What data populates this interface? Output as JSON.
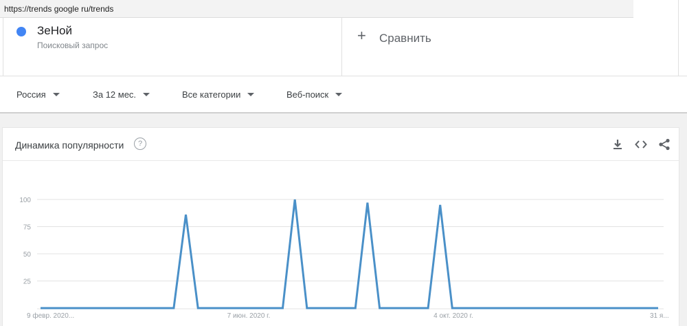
{
  "url_overlay": "https://trends google ru/trends",
  "term": {
    "name": "ЗеНой",
    "subtitle": "Поисковый запрос",
    "color": "#4285f4"
  },
  "compare": {
    "label": "Сравнить"
  },
  "filters": [
    {
      "label": "Россия"
    },
    {
      "label": "За 12 мес."
    },
    {
      "label": "Все категории"
    },
    {
      "label": "Веб-поиск"
    }
  ],
  "chart_card": {
    "title": "Динамика популярности",
    "help_glyph": "?"
  },
  "icons": {
    "download": "download-icon",
    "embed": "embed-code-icon",
    "share": "share-icon"
  },
  "chart_data": {
    "type": "line",
    "title": "Динамика популярности",
    "xlabel": "",
    "ylabel": "",
    "ylim": [
      0,
      100
    ],
    "yticks": [
      25,
      50,
      75,
      100
    ],
    "xtick_labels": [
      "9 февр. 2020...",
      "7 июн. 2020 г.",
      "4 окт. 2020 г.",
      "31 я..."
    ],
    "grid": true,
    "series": [
      {
        "color": "#4a90c8",
        "points": [
          [
            "2020-02-09",
            0
          ],
          [
            "2020-02-16",
            0
          ],
          [
            "2020-02-23",
            0
          ],
          [
            "2020-03-01",
            0
          ],
          [
            "2020-03-08",
            0
          ],
          [
            "2020-03-15",
            0
          ],
          [
            "2020-03-22",
            0
          ],
          [
            "2020-03-29",
            0
          ],
          [
            "2020-04-05",
            0
          ],
          [
            "2020-04-12",
            0
          ],
          [
            "2020-04-19",
            0
          ],
          [
            "2020-04-26",
            0
          ],
          [
            "2020-05-03",
            86
          ],
          [
            "2020-05-10",
            0
          ],
          [
            "2020-05-17",
            0
          ],
          [
            "2020-05-24",
            0
          ],
          [
            "2020-05-31",
            0
          ],
          [
            "2020-06-07",
            0
          ],
          [
            "2020-06-14",
            0
          ],
          [
            "2020-06-21",
            0
          ],
          [
            "2020-06-28",
            0
          ],
          [
            "2020-07-05",
            100
          ],
          [
            "2020-07-12",
            0
          ],
          [
            "2020-07-19",
            0
          ],
          [
            "2020-07-26",
            0
          ],
          [
            "2020-08-02",
            0
          ],
          [
            "2020-08-09",
            0
          ],
          [
            "2020-08-16",
            97
          ],
          [
            "2020-08-23",
            0
          ],
          [
            "2020-08-30",
            0
          ],
          [
            "2020-09-06",
            0
          ],
          [
            "2020-09-13",
            0
          ],
          [
            "2020-09-20",
            0
          ],
          [
            "2020-09-27",
            95
          ],
          [
            "2020-10-04",
            0
          ],
          [
            "2020-10-11",
            0
          ],
          [
            "2020-10-18",
            0
          ],
          [
            "2020-10-25",
            0
          ],
          [
            "2020-11-01",
            0
          ],
          [
            "2020-11-08",
            0
          ],
          [
            "2020-11-15",
            0
          ],
          [
            "2020-11-22",
            0
          ],
          [
            "2020-11-29",
            0
          ],
          [
            "2020-12-06",
            0
          ],
          [
            "2020-12-13",
            0
          ],
          [
            "2020-12-20",
            0
          ],
          [
            "2020-12-27",
            0
          ],
          [
            "2021-01-03",
            0
          ],
          [
            "2021-01-10",
            0
          ],
          [
            "2021-01-17",
            0
          ],
          [
            "2021-01-24",
            0
          ],
          [
            "2021-01-31",
            0
          ]
        ]
      }
    ]
  }
}
